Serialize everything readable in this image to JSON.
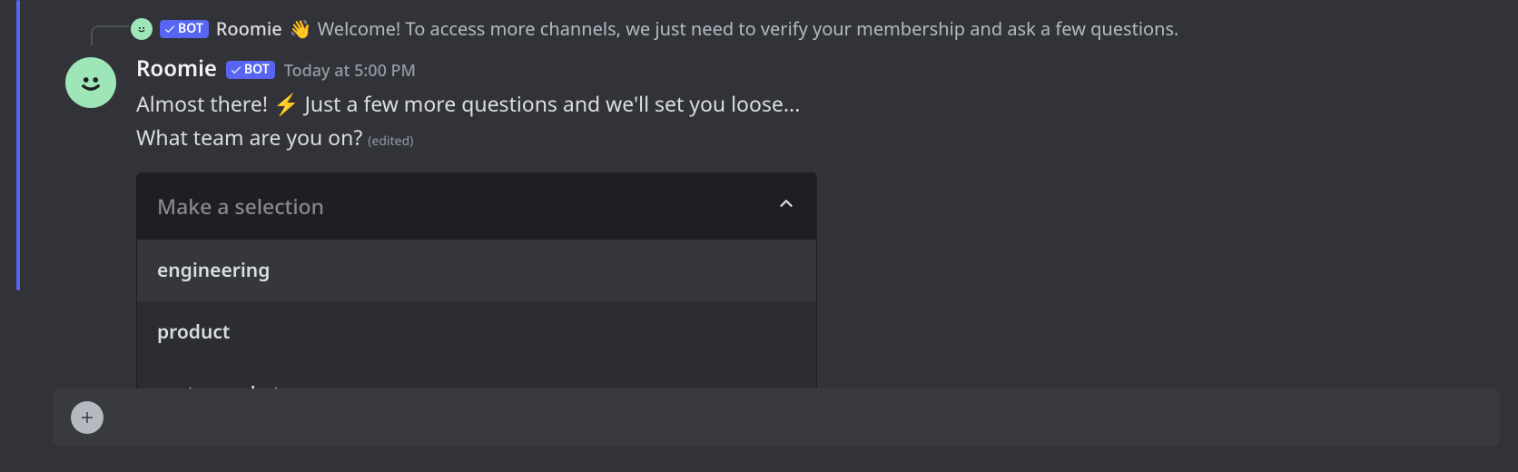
{
  "reply": {
    "author": "Roomie",
    "bot_label": "BOT",
    "wave_emoji": "👋",
    "text": "Welcome! To access more channels, we just need to verify your membership and ask a few questions."
  },
  "message": {
    "author": "Roomie",
    "bot_label": "BOT",
    "timestamp": "Today at 5:00 PM",
    "line1_pre": "Almost there! ",
    "bolt_emoji": "⚡",
    "line1_post": " Just a few more questions and we'll set you loose...",
    "line2": "What team are you on?",
    "edited": "(edited)"
  },
  "select": {
    "placeholder": "Make a selection",
    "options": [
      "engineering",
      "product",
      "go-to-market"
    ]
  }
}
